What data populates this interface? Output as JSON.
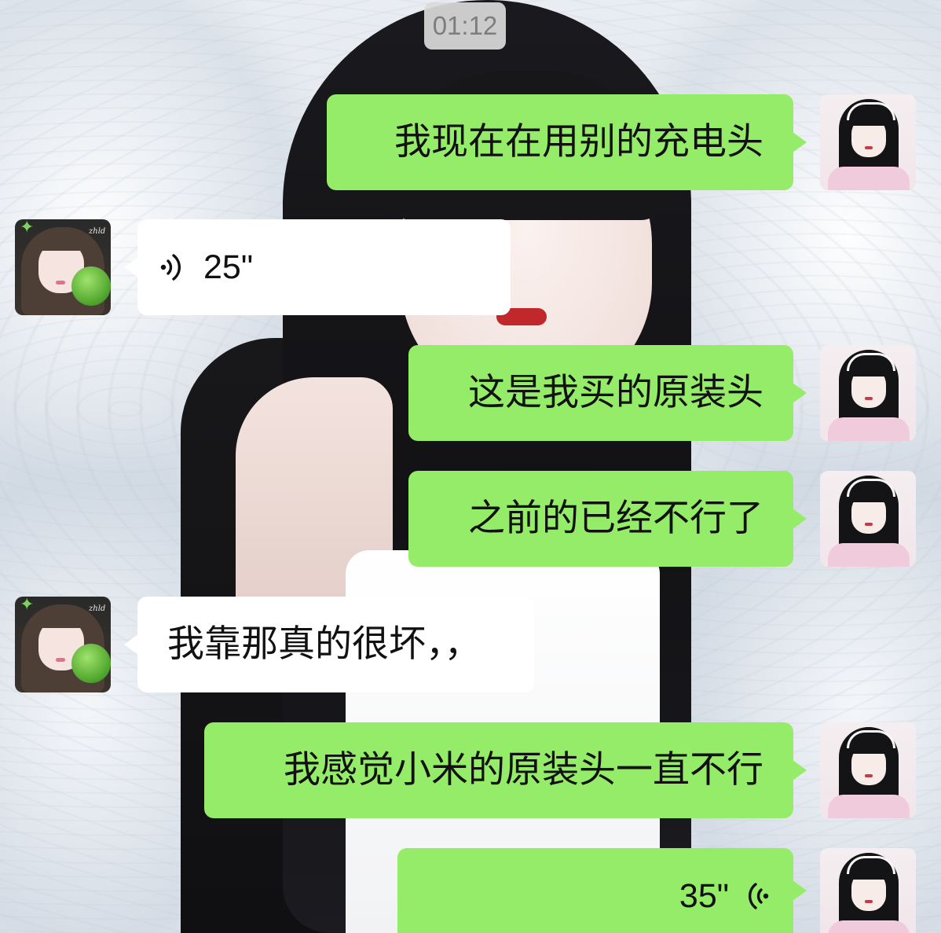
{
  "chat": {
    "timestamp": "01:12",
    "messages": [
      {
        "sender": "self",
        "type": "text",
        "text": "我现在在用别的充电头"
      },
      {
        "sender": "other",
        "type": "voice",
        "duration": "25\""
      },
      {
        "sender": "self",
        "type": "text",
        "text": "这是我买的原装头"
      },
      {
        "sender": "self",
        "type": "text",
        "text": "之前的已经不行了"
      },
      {
        "sender": "other",
        "type": "text",
        "text": "我靠那真的很坏，，"
      },
      {
        "sender": "self",
        "type": "text",
        "text": "我感觉小米的原装头一直不行"
      },
      {
        "sender": "self",
        "type": "voice",
        "duration": "35\""
      }
    ]
  },
  "avatars": {
    "other_tag": "zhld"
  },
  "icons": {
    "voice_received": "voice-wave-icon",
    "voice_sent": "voice-wave-icon",
    "star": "star-icon"
  },
  "colors": {
    "self_bubble": "#95ec69",
    "other_bubble": "#ffffff",
    "timestamp_bg": "#dadada",
    "timestamp_text": "#7d7d7d"
  }
}
